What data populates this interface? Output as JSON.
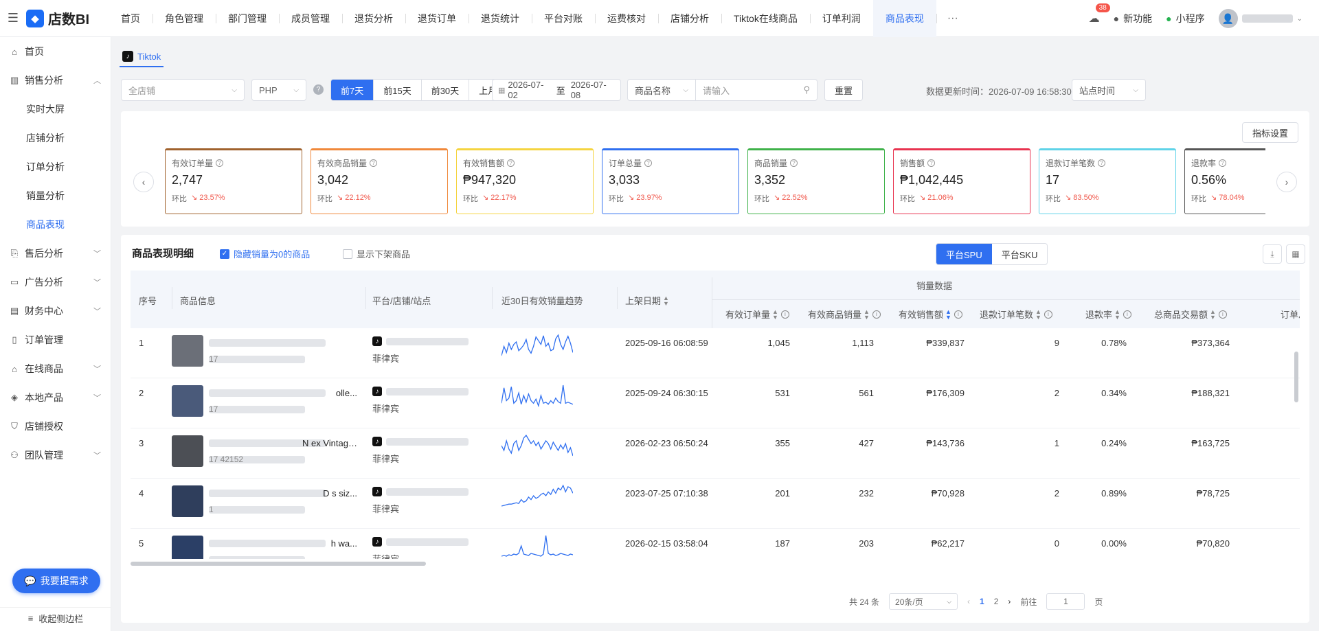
{
  "app": {
    "name": "店数BI"
  },
  "topnav": [
    "首页",
    "角色管理",
    "部门管理",
    "成员管理",
    "退货分析",
    "退货订单",
    "退货统计",
    "平台对账",
    "运费核对",
    "店铺分析",
    "Tiktok在线商品",
    "订单利润",
    "商品表现"
  ],
  "topnav_more": "···",
  "topright": {
    "badge": "38",
    "new_feature": "新功能",
    "miniapp": "小程序"
  },
  "sidebar": {
    "items": [
      {
        "label": "首页",
        "icon": "home-icon"
      },
      {
        "label": "销售分析",
        "icon": "chart-icon",
        "expanded": true
      },
      {
        "label": "售后分析",
        "icon": "aftersale-icon"
      },
      {
        "label": "广告分析",
        "icon": "ad-icon"
      },
      {
        "label": "财务中心",
        "icon": "wallet-icon"
      },
      {
        "label": "订单管理",
        "icon": "document-icon"
      },
      {
        "label": "在线商品",
        "icon": "shop-icon"
      },
      {
        "label": "本地产品",
        "icon": "box-icon"
      },
      {
        "label": "店铺授权",
        "icon": "shield-icon"
      },
      {
        "label": "团队管理",
        "icon": "team-icon"
      }
    ],
    "sub_items": [
      "实时大屏",
      "店铺分析",
      "订单分析",
      "销量分析",
      "商品表现"
    ],
    "help_button": "我要提需求",
    "collapse": "收起侧边栏"
  },
  "tab": {
    "label": "Tiktok"
  },
  "filters": {
    "store": "全店铺",
    "currency": "PHP",
    "ranges": [
      "前7天",
      "前15天",
      "前30天",
      "上月"
    ],
    "active_range": "前7天",
    "date_start": "2026-07-02",
    "date_sep": "至",
    "date_end": "2026-07-08",
    "field": "商品名称",
    "search_placeholder": "请输入",
    "reset": "重置",
    "update_time": "数据更新时间：2026-07-09 16:58:30",
    "timezone": "站点时间"
  },
  "kpi": {
    "settings_button": "指标设置",
    "compare_label": "环比",
    "cards": [
      {
        "label": "有效订单量",
        "value": "2,747",
        "change": "23.57%",
        "color": "#a0622d"
      },
      {
        "label": "有效商品销量",
        "value": "3,042",
        "change": "22.12%",
        "color": "#f0883a"
      },
      {
        "label": "有效销售额",
        "value": "₱947,320",
        "change": "22.17%",
        "color": "#f5d440"
      },
      {
        "label": "订单总量",
        "value": "3,033",
        "change": "23.97%",
        "color": "#2f6ff0"
      },
      {
        "label": "商品销量",
        "value": "3,352",
        "change": "22.52%",
        "color": "#3fb24a"
      },
      {
        "label": "销售额",
        "value": "₱1,042,445",
        "change": "21.06%",
        "color": "#e8334f"
      },
      {
        "label": "退款订单笔数",
        "value": "17",
        "change": "83.50%",
        "color": "#5fd3e8"
      },
      {
        "label": "退款率",
        "value": "0.56%",
        "change": "78.04%",
        "color": "#555555"
      }
    ]
  },
  "detail": {
    "title": "商品表现明细",
    "hide_zero": "隐藏销量为0的商品",
    "show_delisted": "显示下架商品",
    "view_spu": "平台SPU",
    "view_sku": "平台SKU",
    "columns": {
      "index": "序号",
      "product": "商品信息",
      "platform": "平台/店铺/站点",
      "trend": "近30日有效销量趋势",
      "listed": "上架日期",
      "group": "销量数据",
      "orders": "有效订单量",
      "units": "有效商品销量",
      "sales": "有效销售额",
      "refunds": "退款订单笔数",
      "refund_rate": "退款率",
      "gmv": "总商品交易额",
      "more": "订单总"
    },
    "rows": [
      {
        "idx": "1",
        "name": "",
        "id": "17",
        "site": "菲律宾",
        "date": "2025-09-16 06:08:59",
        "orders": "1,045",
        "units": "1,113",
        "sales": "₱339,837",
        "refunds": "9",
        "rate": "0.78%",
        "gmv": "₱373,364",
        "thumb": "#6b6f78",
        "trend": [
          40,
          55,
          45,
          60,
          50,
          58,
          62,
          48,
          52,
          57,
          66,
          50,
          44,
          55,
          70,
          64,
          58,
          72,
          55,
          60,
          48,
          50,
          67,
          73,
          58,
          50,
          62,
          71,
          60,
          45
        ]
      },
      {
        "idx": "2",
        "name": "olle...",
        "id": "17",
        "site": "菲律宾",
        "date": "2025-09-24 06:30:15",
        "orders": "531",
        "units": "561",
        "sales": "₱176,309",
        "refunds": "2",
        "rate": "0.34%",
        "gmv": "₱188,321",
        "thumb": "#4a5a7a",
        "trend": [
          40,
          70,
          45,
          50,
          72,
          40,
          45,
          60,
          38,
          55,
          42,
          58,
          45,
          40,
          48,
          35,
          55,
          40,
          42,
          38,
          45,
          40,
          50,
          43,
          40,
          75,
          40,
          42,
          40,
          38
        ]
      },
      {
        "idx": "3",
        "name": "N              ex Vintage ...",
        "id": "17             42152",
        "site": "菲律宾",
        "date": "2026-02-23 06:50:24",
        "orders": "355",
        "units": "427",
        "sales": "₱143,736",
        "refunds": "1",
        "rate": "0.24%",
        "gmv": "₱163,725",
        "thumb": "#4c4f55",
        "trend": [
          55,
          48,
          62,
          50,
          44,
          58,
          62,
          48,
          55,
          66,
          70,
          64,
          58,
          62,
          55,
          60,
          50,
          56,
          62,
          58,
          50,
          60,
          54,
          48,
          56,
          50,
          58,
          45,
          52,
          40
        ]
      },
      {
        "idx": "4",
        "name": "D             s siz...",
        "id": "1",
        "site": "菲律宾",
        "date": "2023-07-25 07:10:38",
        "orders": "201",
        "units": "232",
        "sales": "₱70,928",
        "refunds": "2",
        "rate": "0.89%",
        "gmv": "₱78,725",
        "thumb": "#2f3e5c",
        "trend": [
          30,
          31,
          32,
          33,
          33,
          34,
          35,
          34,
          40,
          36,
          38,
          44,
          40,
          46,
          42,
          44,
          48,
          50,
          46,
          52,
          48,
          56,
          50,
          58,
          55,
          62,
          52,
          60,
          58,
          50
        ]
      },
      {
        "idx": "5",
        "name": "h wa...",
        "id": "",
        "site": "菲律宾",
        "date": "2026-02-15 03:58:04",
        "orders": "187",
        "units": "203",
        "sales": "₱62,217",
        "refunds": "0",
        "rate": "0.00%",
        "gmv": "₱70,820",
        "thumb": "#2b3f66",
        "trend": [
          30,
          31,
          30,
          32,
          31,
          33,
          32,
          34,
          45,
          33,
          32,
          31,
          34,
          33,
          32,
          31,
          30,
          33,
          60,
          34,
          32,
          33,
          31,
          32,
          34,
          33,
          32,
          31,
          33,
          32
        ]
      }
    ],
    "pager": {
      "total": "共 24 条",
      "size": "20条/页",
      "pages": [
        "1",
        "2"
      ],
      "goto_label": "前往",
      "goto_value": "1",
      "goto_suffix": "页"
    }
  }
}
